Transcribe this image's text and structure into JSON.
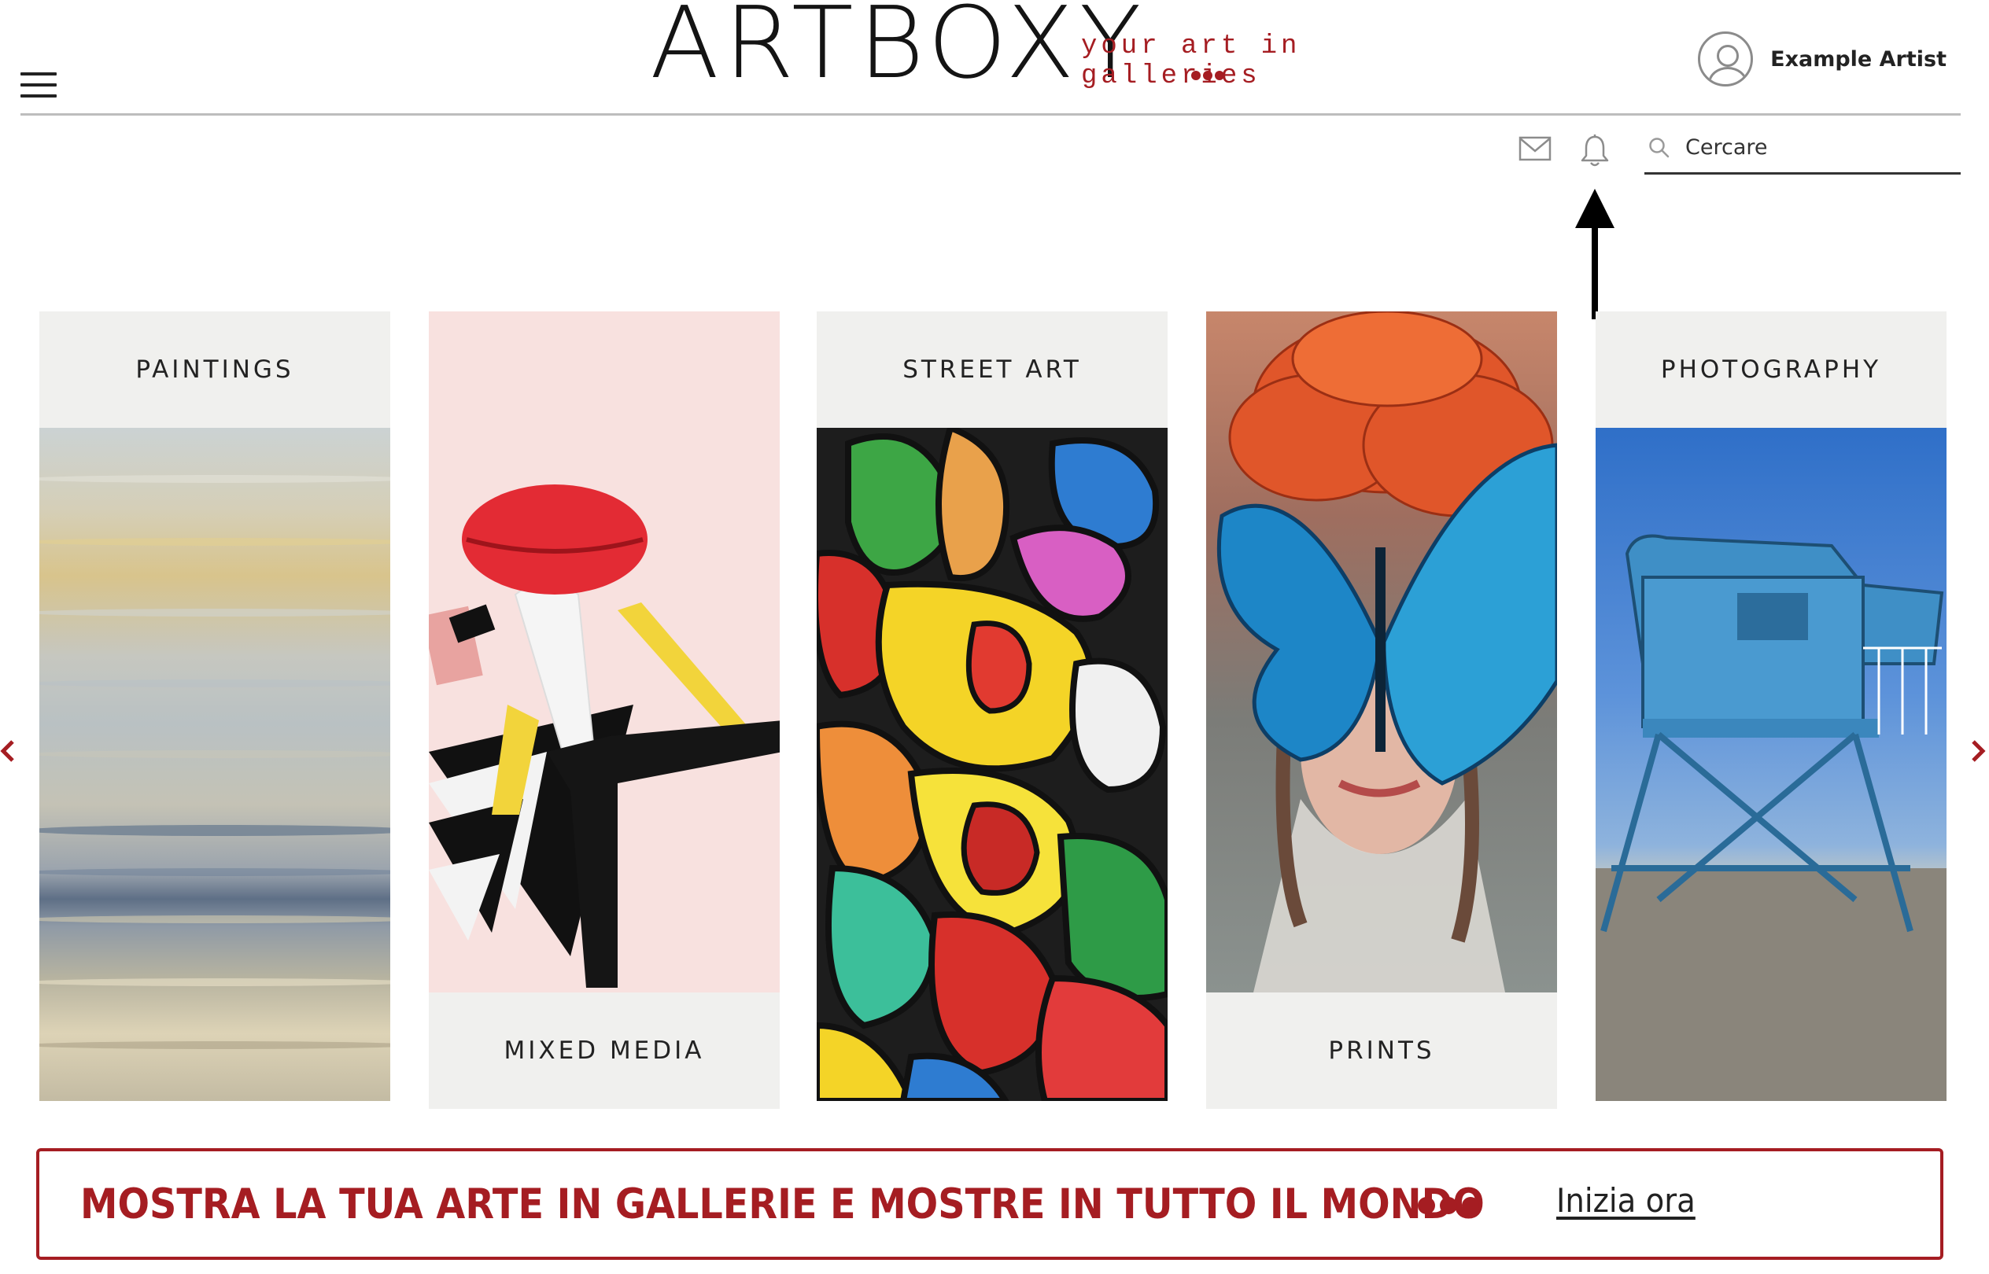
{
  "header": {
    "logo_word": "ARTBOXY",
    "logo_tagline": "your art in galleries",
    "profile_name": "Example Artist"
  },
  "toolbar": {
    "mail_icon": "mail-icon",
    "bell_icon": "bell-icon",
    "search_placeholder": "Cercare",
    "search_value": ""
  },
  "categories": [
    {
      "label": "PAINTINGS",
      "label_position": "top"
    },
    {
      "label": "MIXED MEDIA",
      "label_position": "bottom"
    },
    {
      "label": "STREET ART",
      "label_position": "top"
    },
    {
      "label": "PRINTS",
      "label_position": "bottom"
    },
    {
      "label": "PHOTOGRAPHY",
      "label_position": "top"
    }
  ],
  "carousel": {
    "prev_icon": "chevron-left-icon",
    "next_icon": "chevron-right-icon"
  },
  "banner": {
    "text": "MOSTRA LA TUA ARTE IN GALLERIE E MOSTRE IN TUTTO IL MONDO",
    "cta": "Inizia ora"
  },
  "colors": {
    "brand_red": "#a51d22",
    "card_label_bg": "#f0f0ee",
    "text_dark": "#222222"
  }
}
